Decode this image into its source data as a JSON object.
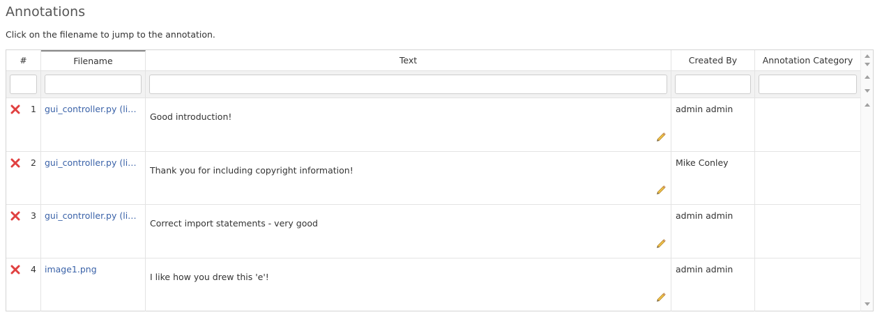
{
  "page": {
    "title": "Annotations",
    "subtitle": "Click on the filename to jump to the annotation."
  },
  "table": {
    "columns": [
      "#",
      "Filename",
      "Text",
      "Created By",
      "Annotation Category"
    ],
    "filters": {
      "num": "",
      "filename": "",
      "text": "",
      "created_by": "",
      "category": ""
    },
    "rows": [
      {
        "num": "1",
        "filename": "gui_controller.py (line...",
        "text": "Good introduction!",
        "created_by": "admin admin",
        "category": ""
      },
      {
        "num": "2",
        "filename": "gui_controller.py (line...",
        "text": "Thank you for including copyright information!",
        "created_by": "Mike Conley",
        "category": ""
      },
      {
        "num": "3",
        "filename": "gui_controller.py (line...",
        "text": "Correct import statements - very good",
        "created_by": "admin admin",
        "category": ""
      },
      {
        "num": "4",
        "filename": "image1.png",
        "text": "I like how you drew this 'e'!",
        "created_by": "admin admin",
        "category": ""
      }
    ]
  },
  "icons": {
    "delete": "delete-x-icon",
    "edit": "pencil-icon",
    "scroll_up": "arrow-up-icon",
    "scroll_down": "arrow-down-icon"
  },
  "colors": {
    "link": "#3a62a8",
    "delete": "#e04040",
    "pencil": "#e8b43a",
    "border": "#d4d4d4"
  }
}
